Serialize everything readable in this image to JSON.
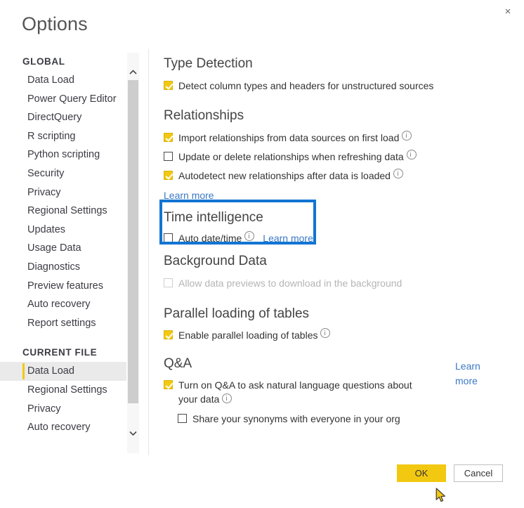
{
  "window": {
    "title": "Options",
    "close_icon": "close-icon",
    "close_label": "×"
  },
  "sidebar": {
    "groups": [
      {
        "title": "GLOBAL",
        "items": [
          {
            "label": "Data Load",
            "selected": false
          },
          {
            "label": "Power Query Editor",
            "selected": false
          },
          {
            "label": "DirectQuery",
            "selected": false
          },
          {
            "label": "R scripting",
            "selected": false
          },
          {
            "label": "Python scripting",
            "selected": false
          },
          {
            "label": "Security",
            "selected": false
          },
          {
            "label": "Privacy",
            "selected": false
          },
          {
            "label": "Regional Settings",
            "selected": false
          },
          {
            "label": "Updates",
            "selected": false
          },
          {
            "label": "Usage Data",
            "selected": false
          },
          {
            "label": "Diagnostics",
            "selected": false
          },
          {
            "label": "Preview features",
            "selected": false
          },
          {
            "label": "Auto recovery",
            "selected": false
          },
          {
            "label": "Report settings",
            "selected": false
          }
        ]
      },
      {
        "title": "CURRENT FILE",
        "items": [
          {
            "label": "Data Load",
            "selected": true
          },
          {
            "label": "Regional Settings",
            "selected": false
          },
          {
            "label": "Privacy",
            "selected": false
          },
          {
            "label": "Auto recovery",
            "selected": false
          }
        ]
      }
    ],
    "scrollbar": {
      "up_icon": "chevron-up-icon",
      "down_icon": "chevron-down-icon"
    },
    "selected_accent_color": "#f2c811"
  },
  "main": {
    "sections": [
      {
        "id": "type-detection",
        "title": "Type Detection",
        "options": [
          {
            "label": "Detect column types and headers for unstructured sources",
            "checked": true,
            "info": false,
            "disabled": false,
            "indent": false
          }
        ]
      },
      {
        "id": "relationships",
        "title": "Relationships",
        "options": [
          {
            "label": "Import relationships from data sources on first load",
            "checked": true,
            "info": true,
            "disabled": false,
            "indent": false
          },
          {
            "label": "Update or delete relationships when refreshing data",
            "checked": false,
            "info": true,
            "disabled": false,
            "indent": false
          },
          {
            "label": "Autodetect new relationships after data is loaded",
            "checked": true,
            "info": true,
            "disabled": false,
            "indent": false
          }
        ],
        "learn_more": "Learn more"
      },
      {
        "id": "time-intelligence",
        "title": "Time intelligence",
        "highlighted": true,
        "options": [
          {
            "label": "Auto date/time",
            "checked": false,
            "info": true,
            "disabled": false,
            "indent": false,
            "inline_link": "Learn more"
          }
        ]
      },
      {
        "id": "background-data",
        "title": "Background Data",
        "options": [
          {
            "label": "Allow data previews to download in the background",
            "checked": false,
            "info": false,
            "disabled": true,
            "indent": false
          }
        ]
      },
      {
        "id": "parallel-loading",
        "title": "Parallel loading of tables",
        "options": [
          {
            "label": "Enable parallel loading of tables",
            "checked": true,
            "info": true,
            "disabled": false,
            "indent": false
          }
        ]
      },
      {
        "id": "qa",
        "title": "Q&A",
        "options": [
          {
            "label": "Turn on Q&A to ask natural language questions about your data",
            "checked": true,
            "info": true,
            "disabled": false,
            "indent": false
          },
          {
            "label": "Share your synonyms with everyone in your org",
            "checked": false,
            "info": false,
            "disabled": false,
            "indent": true
          }
        ],
        "side_link": "Learn more"
      }
    ]
  },
  "footer": {
    "ok_label": "OK",
    "cancel_label": "Cancel"
  },
  "colors": {
    "accent": "#f2c811",
    "highlight_box": "#1274d3",
    "link": "#3a79c4",
    "selected_row_bg": "#eaeaea"
  },
  "cursor": {
    "icon": "arrow-cursor-icon"
  }
}
